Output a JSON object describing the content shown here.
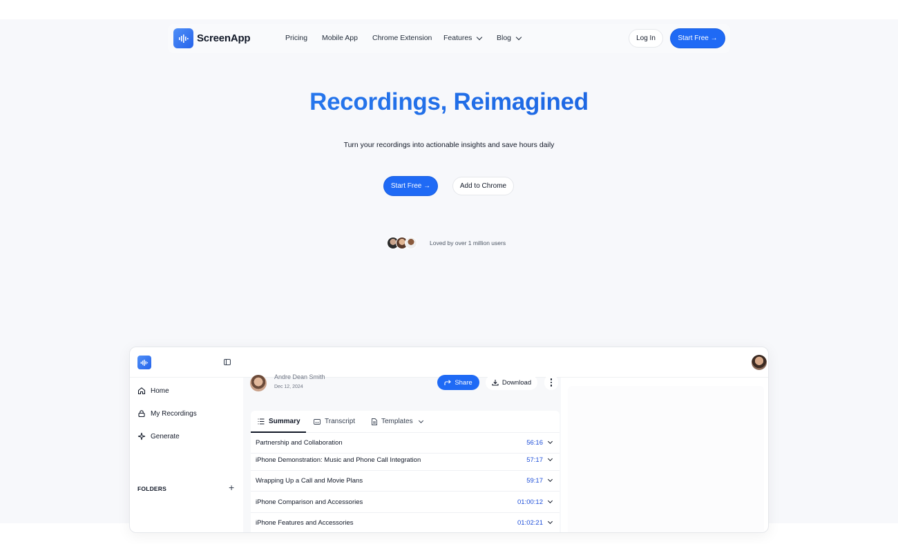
{
  "nav": {
    "brand": "ScreenApp",
    "links": [
      "Pricing",
      "Mobile App",
      "Chrome Extension",
      "Features",
      "Blog"
    ],
    "login": "Log In",
    "start": "Start Free →"
  },
  "hero": {
    "title": "Recordings, Reimagined",
    "subtitle": "Turn your recordings into actionable insights and save hours daily",
    "cta_primary": "Start Free →",
    "cta_secondary": "Add to Chrome",
    "social_proof": "Loved by over 1 million users"
  },
  "app": {
    "sidebar": {
      "items": [
        {
          "label": "Home",
          "icon": "home-icon"
        },
        {
          "label": "My Recordings",
          "icon": "lock-icon"
        },
        {
          "label": "Generate",
          "icon": "sparkle-icon"
        }
      ],
      "folders_label": "FOLDERS",
      "folders_add": "+"
    },
    "recording": {
      "owner": "Andre Dean Smith",
      "date": "Dec 12, 2024",
      "share": "Share",
      "download": "Download"
    },
    "tabs": [
      "Summary",
      "Transcript",
      "Templates"
    ],
    "chapters": [
      {
        "title": "Partnership and Collaboration",
        "time": "56:16"
      },
      {
        "title": "iPhone Demonstration: Music and Phone Call Integration",
        "time": "57:17"
      },
      {
        "title": "Wrapping Up a Call and Movie Plans",
        "time": "59:17"
      },
      {
        "title": "iPhone Comparison and Accessories",
        "time": "01:00:12"
      },
      {
        "title": "iPhone Features and Accessories",
        "time": "01:02:21"
      }
    ]
  },
  "colors": {
    "accent": "#1f6af5",
    "title_gradient_start": "#2f86f6",
    "title_gradient_end": "#1457d9",
    "time_color": "#1d4ed8"
  }
}
